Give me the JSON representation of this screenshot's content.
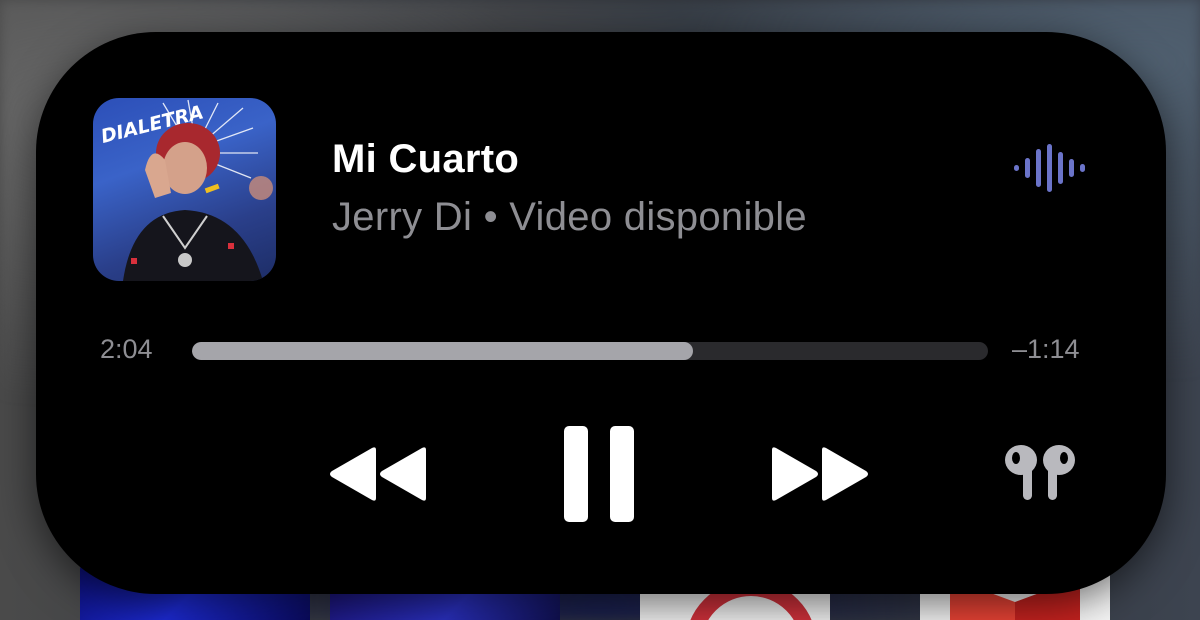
{
  "now_playing": {
    "song_title": "Mi Cuarto",
    "subtitle": "Jerry Di • Video disponible",
    "artwork_text": "DIALETRA",
    "progress_fraction": 0.63
  },
  "playback": {
    "elapsed": "2:04",
    "remaining": "–1:14"
  },
  "controls": {
    "rewind_icon": "backward-icon",
    "pause_icon": "pause-icon",
    "forward_icon": "forward-icon",
    "output_icon": "airpods-icon"
  },
  "colors": {
    "island_bg": "#000000",
    "title": "#ffffff",
    "secondary": "#8e8e93",
    "progress_fill": "#a5a5aa",
    "progress_track": "#2a2a2d",
    "wave": "#6b74c9"
  }
}
